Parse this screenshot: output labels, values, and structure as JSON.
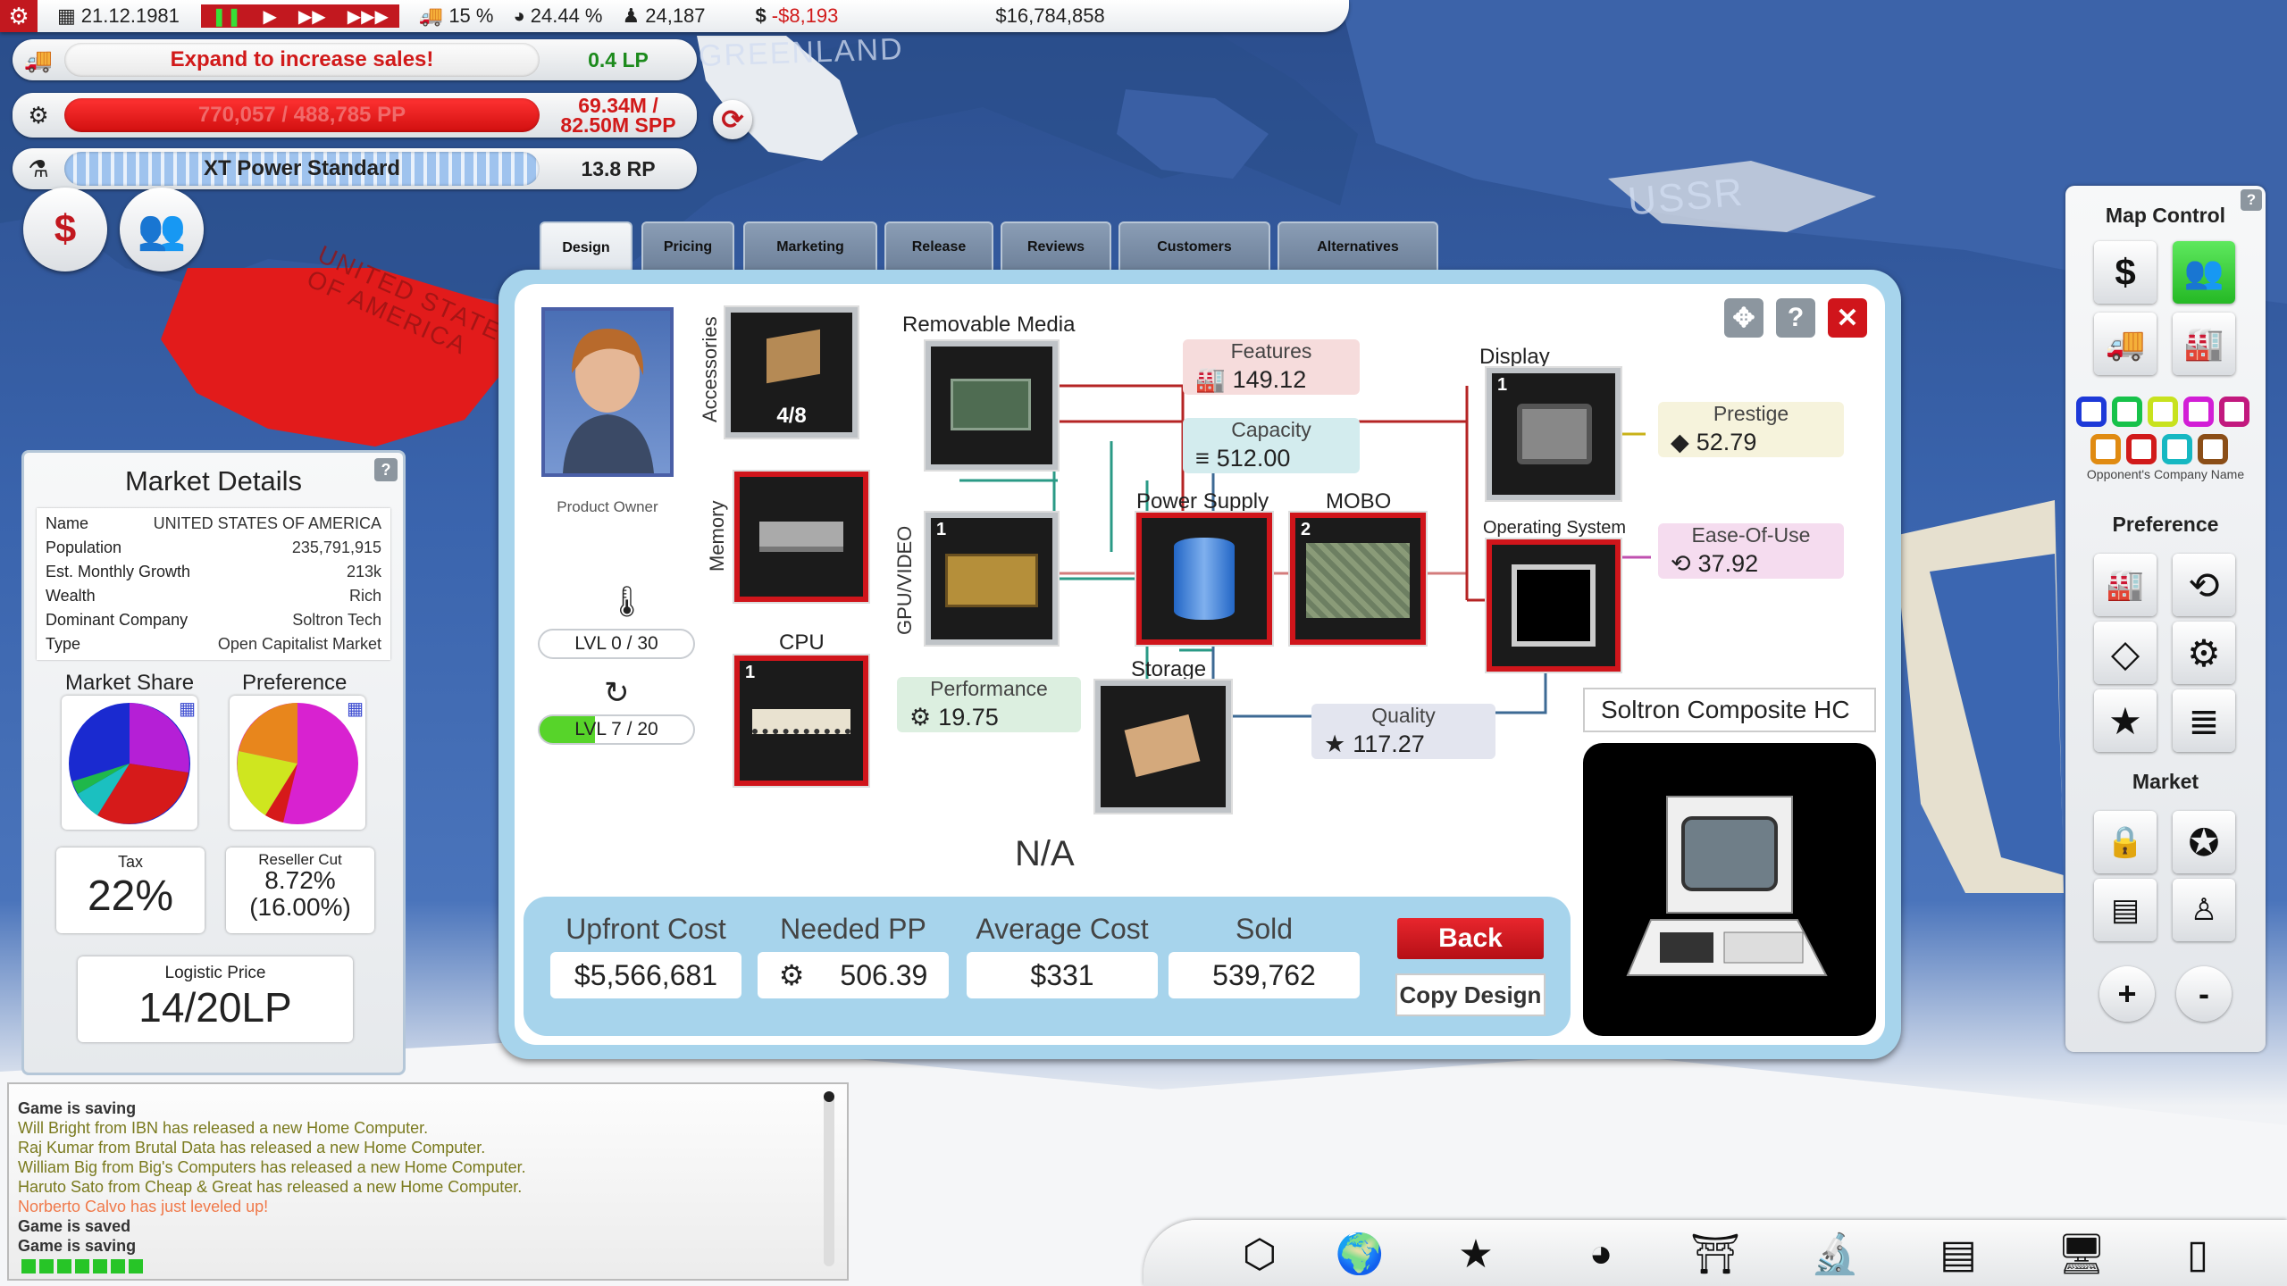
{
  "topbar": {
    "date": "21.12.1981",
    "share": "15 %",
    "rate": "24.44 %",
    "fans": "24,187",
    "profit": "-$8,193",
    "money": "$16,784,858"
  },
  "status": {
    "sales_msg": "Expand to increase sales!",
    "lp": "0.4 LP",
    "pp_bar": "770,057 / 488,785 PP",
    "pp_val_1": "69.34M /",
    "pp_val_2": "82.50M SPP",
    "research": "XT Power Standard",
    "rp": "13.8 RP"
  },
  "map": {
    "greenland": "GREENLAND",
    "ussr": "USSR",
    "usa": "UNITED STATES OF AMERICA"
  },
  "tabs": [
    "Design",
    "Pricing",
    "Marketing",
    "Release",
    "Reviews",
    "Customers",
    "Alternatives"
  ],
  "design": {
    "owner_label": "Product Owner",
    "lvl1": "LVL 0 / 30",
    "lvl2": "LVL 7 / 20",
    "accessories": "Accessories",
    "accessories_count": "4/8",
    "removable_media": "Removable Media",
    "memory": "Memory",
    "gpu": "GPU/VIDEO",
    "gpu_num": "1",
    "cpu": "CPU",
    "cpu_num": "1",
    "power_supply": "Power Supply",
    "mobo": "MOBO",
    "mobo_num": "2",
    "storage": "Storage",
    "display": "Display",
    "display_num": "1",
    "os": "Operating System",
    "features_lbl": "Features",
    "features_val": "149.12",
    "capacity_lbl": "Capacity",
    "capacity_val": "512.00",
    "performance_lbl": "Performance",
    "performance_val": "19.75",
    "quality_lbl": "Quality",
    "quality_val": "117.27",
    "prestige_lbl": "Prestige",
    "prestige_val": "52.79",
    "ease_lbl": "Ease-Of-Use",
    "ease_val": "37.92",
    "na": "N/A",
    "product_name": "Soltron Composite HC"
  },
  "costs": {
    "upfront_lbl": "Upfront Cost",
    "upfront": "$5,566,681",
    "pp_lbl": "Needed PP",
    "pp": "506.39",
    "avg_lbl": "Average Cost",
    "avg": "$331",
    "sold_lbl": "Sold",
    "sold": "539,762",
    "back": "Back",
    "copy": "Copy Design"
  },
  "market": {
    "title": "Market Details",
    "rows": [
      [
        "Name",
        "UNITED STATES OF AMERICA"
      ],
      [
        "Population",
        "235,791,915"
      ],
      [
        "Est. Monthly Growth",
        "213k"
      ],
      [
        "Wealth",
        "Rich"
      ],
      [
        "Dominant Company",
        "Soltron Tech"
      ],
      [
        "Type",
        "Open Capitalist Market"
      ]
    ],
    "share_lbl": "Market Share",
    "pref_lbl": "Preference",
    "tax_lbl": "Tax",
    "tax": "22%",
    "reseller_lbl": "Reseller Cut",
    "reseller_1": "8.72%",
    "reseller_2": "(16.00%)",
    "logistic_lbl": "Logistic Price",
    "logistic": "14/20LP"
  },
  "mapctl": {
    "title": "Map Control",
    "opp": "Opponent's Company Name",
    "pref": "Preference",
    "market": "Market",
    "swatch_colors": [
      "#1d39d8",
      "#17c24a",
      "#c8e21e",
      "#d21ed6",
      "#c2197e",
      "#e08b12",
      "#d11a1a",
      "#16b8c2",
      "#8b4e17"
    ]
  },
  "log": [
    "Game is saving",
    "Will Bright from IBN has released a new Home Computer.",
    "Raj Kumar from Brutal Data has released a new Home Computer.",
    "William Big from Big's Computers has released a new Home Computer.",
    "Haruto Sato from Cheap & Great has released a new Home Computer.",
    "Norberto Calvo has just leveled up!",
    "Game is saved",
    "Game is saving"
  ],
  "colors": {
    "accent_red": "#c2181f",
    "panel_blue": "#a7d4ec",
    "log_olive": "#7a7a1e",
    "log_orange": "#f0794a"
  }
}
